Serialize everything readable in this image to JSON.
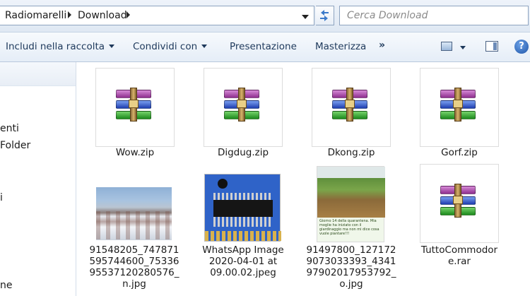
{
  "address": {
    "crumbs": [
      "Radiomarelli",
      "Download"
    ]
  },
  "search": {
    "placeholder": "Cerca Download"
  },
  "toolbar": {
    "include_label": "Includi nella raccolta",
    "share_label": "Condividi con",
    "slideshow_label": "Presentazione",
    "burn_label": "Masterizza",
    "more_label": "»",
    "help_label": "?"
  },
  "nav": {
    "items": [
      "enti",
      "Folder",
      "i",
      "ne"
    ]
  },
  "files": [
    {
      "name": "Wow.zip",
      "icon": "winrar-archive-icon"
    },
    {
      "name": "Digdug.zip",
      "icon": "winrar-archive-icon"
    },
    {
      "name": "Dkong.zip",
      "icon": "winrar-archive-icon"
    },
    {
      "name": "Gorf.zip",
      "icon": "winrar-archive-icon"
    },
    {
      "name_lines": [
        "91548205_747871",
        "595744600_75336",
        "95537120280576_",
        "n.jpg"
      ],
      "icon": "snowy-town-photo"
    },
    {
      "name_lines": [
        "WhatsApp Image",
        "2020-04-01 at",
        "09.00.02.jpeg"
      ],
      "icon": "circuit-board-photo"
    },
    {
      "name_lines": [
        "91497800_127172",
        "9073033393_4341",
        "97902017953792_",
        "o.jpg"
      ],
      "icon": "field-trench-photo"
    },
    {
      "name_lines": [
        "TuttoCommodor",
        "e.rar"
      ],
      "icon": "winrar-archive-icon"
    }
  ],
  "photo_caption": "Giorno 14 della quarantena. Mia moglie ha iniziato con il giardinaggio ma non mi dice cosa vuole piantare!!!"
}
